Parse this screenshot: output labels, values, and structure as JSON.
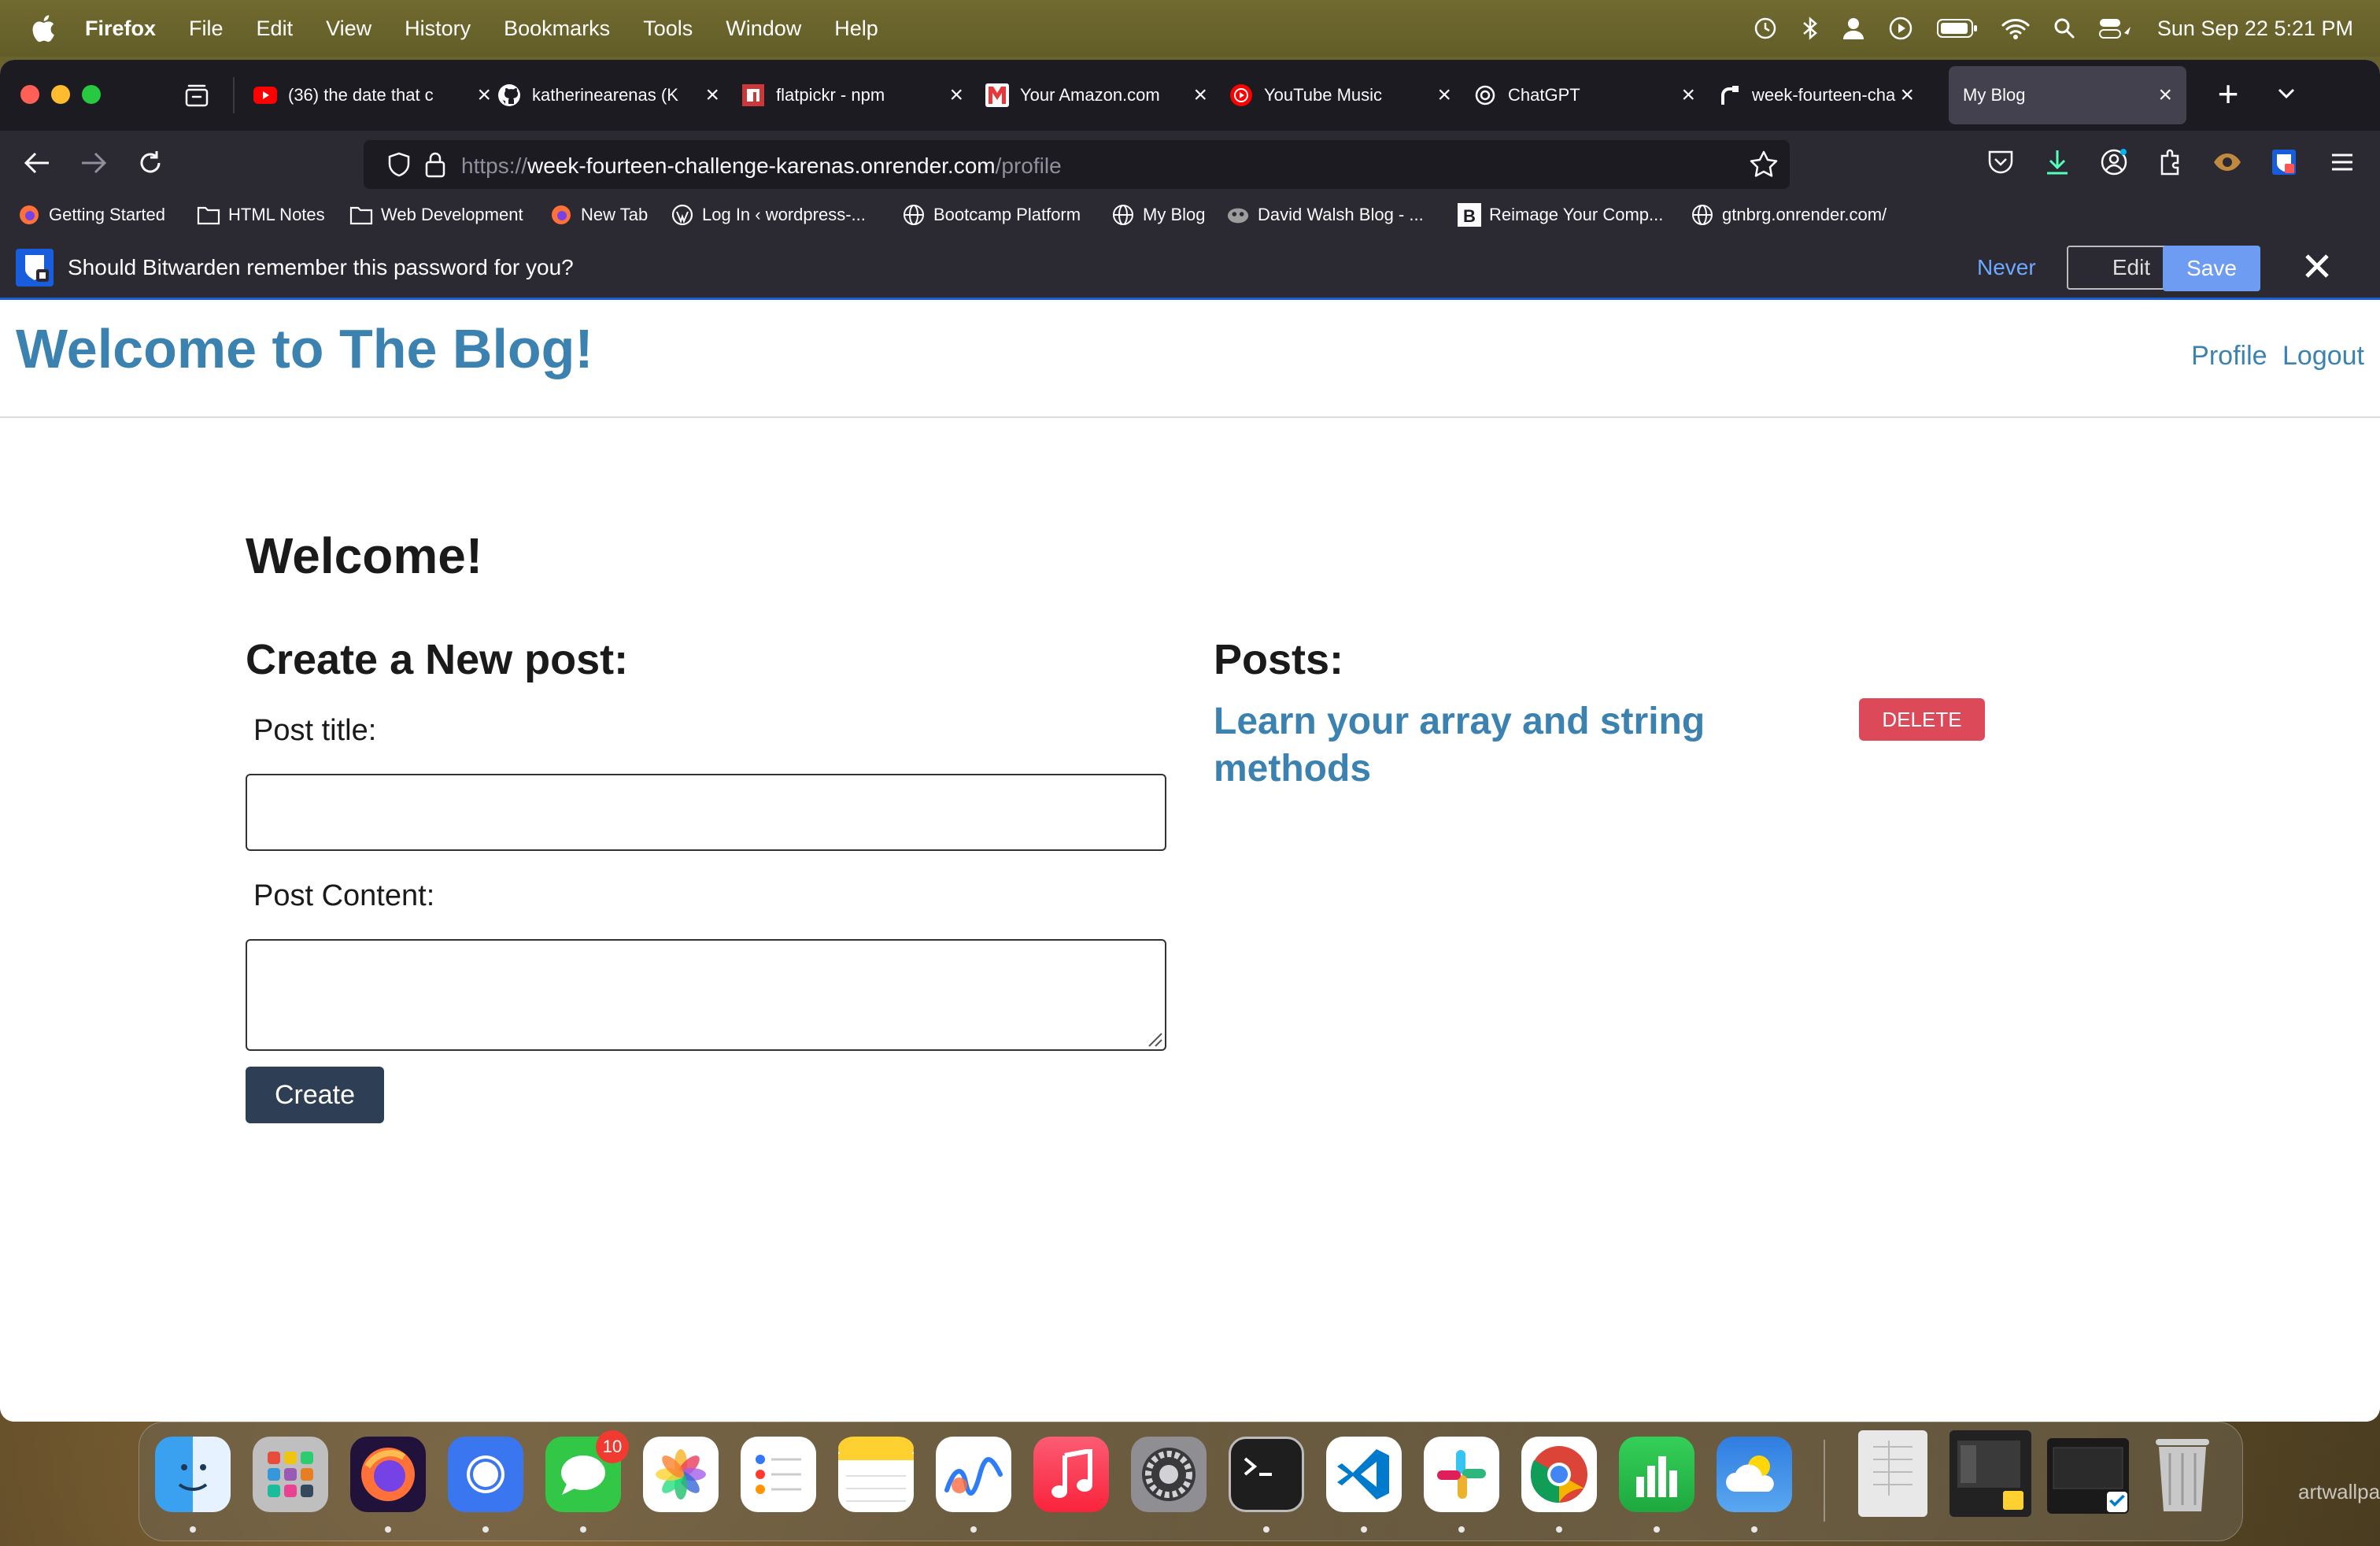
{
  "menubar": {
    "app": "Firefox",
    "items": [
      "File",
      "Edit",
      "View",
      "History",
      "Bookmarks",
      "Tools",
      "Window",
      "Help"
    ],
    "clock": "Sun Sep 22  5:21 PM"
  },
  "tabs": [
    {
      "label": "(36) the date that c",
      "icon": "youtube-icon"
    },
    {
      "label": "katherinearenas (K",
      "icon": "github-icon"
    },
    {
      "label": "flatpickr - npm",
      "icon": "npm-icon"
    },
    {
      "label": "Your Amazon.com",
      "icon": "amazon-icon"
    },
    {
      "label": "YouTube Music",
      "icon": "youtube-music-icon"
    },
    {
      "label": "ChatGPT",
      "icon": "chatgpt-icon"
    },
    {
      "label": "week-fourteen-cha",
      "icon": "render-icon"
    },
    {
      "label": "My Blog",
      "icon": "none",
      "active": true
    }
  ],
  "urlbar": {
    "scheme": "https://",
    "host": "week-fourteen-challenge-karenas.onrender.com",
    "path": "/profile"
  },
  "bookmarks": [
    {
      "label": "Getting Started",
      "icon": "firefox-icon"
    },
    {
      "label": "HTML Notes",
      "icon": "folder-icon"
    },
    {
      "label": "Web Development",
      "icon": "folder-icon"
    },
    {
      "label": "New Tab",
      "icon": "firefox-icon"
    },
    {
      "label": "Log In ‹ wordpress-...",
      "icon": "wordpress-icon"
    },
    {
      "label": "Bootcamp Platform",
      "icon": "globe-icon"
    },
    {
      "label": "My Blog",
      "icon": "globe-icon"
    },
    {
      "label": "David Walsh Blog - ...",
      "icon": "dwb-icon"
    },
    {
      "label": "Reimage Your Comp...",
      "icon": "b-icon"
    },
    {
      "label": "gtnbrg.onrender.com/",
      "icon": "globe-icon"
    }
  ],
  "bitwarden": {
    "message": "Should Bitwarden remember this password for you?",
    "never": "Never",
    "edit": "Edit",
    "save": "Save"
  },
  "page": {
    "site_title": "Welcome to The Blog!",
    "nav_profile": "Profile",
    "nav_logout": "Logout",
    "welcome": "Welcome!",
    "create_heading": "Create a New post:",
    "title_label": "Post title:",
    "content_label": "Post Content:",
    "title_value": "",
    "content_value": "",
    "create_button": "Create",
    "posts_heading": "Posts:",
    "posts": [
      {
        "title": "Learn your array and string methods",
        "delete_label": "DELETE"
      }
    ]
  },
  "dock": {
    "apps": [
      "Finder",
      "Launchpad",
      "Firefox",
      "Signal",
      "Messages",
      "Photos",
      "Reminders",
      "Notes",
      "Freeform",
      "Music",
      "System Settings",
      "Terminal",
      "Visual Studio Code",
      "Slack",
      "Google Chrome",
      "Numbers",
      "Weather"
    ],
    "messages_badge": "10"
  },
  "watermark": "artwallpaper.",
  "colors": {
    "link_blue": "#3b82b0",
    "delete_red": "#dc4a5a",
    "create_button": "#2e3f55",
    "bitwarden_blue": "#175ddc"
  }
}
